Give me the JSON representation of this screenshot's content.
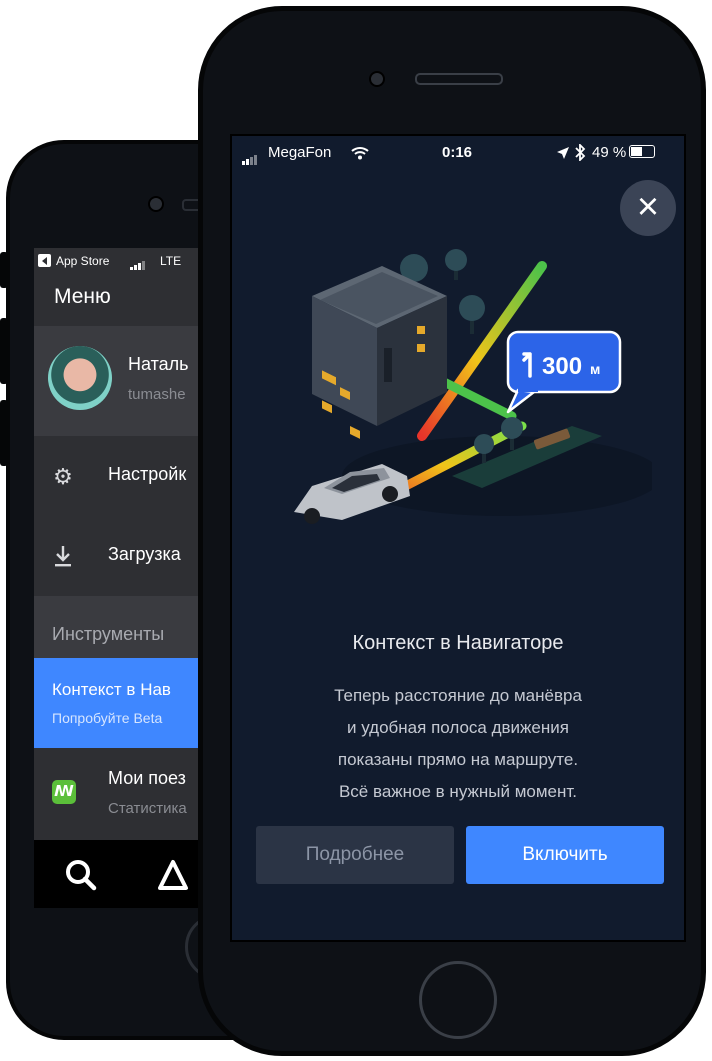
{
  "back_screen": {
    "status": {
      "back_label": "App Store",
      "network": "LTE"
    },
    "menu_title": "Меню",
    "profile": {
      "name": "Наталь",
      "email": "tumashe"
    },
    "items": [
      {
        "label": "Настройк",
        "icon": "gear-icon"
      },
      {
        "label": "Загрузка",
        "icon": "download-icon"
      }
    ],
    "section_title": "Инструменты",
    "highlight": {
      "title": "Контекст в Нав",
      "subtitle": "Попробуйте Beta"
    },
    "trips": {
      "title": "Мои поез",
      "subtitle": "Статистика",
      "icon": "trips-icon"
    },
    "tabbar": [
      {
        "icon": "search-icon"
      },
      {
        "icon": "navigation-arrow-icon"
      }
    ]
  },
  "front_screen": {
    "status": {
      "carrier": "MegaFon",
      "time": "0:16",
      "battery": "49 %"
    },
    "close_icon": "close-icon",
    "illustration": {
      "distance_value": "300",
      "distance_unit": "м",
      "turn_icon": "turn-left-arrow-icon",
      "colors": {
        "route_red": "#e8342a",
        "route_yellow": "#f0c419",
        "route_green": "#4cc24a",
        "bubble": "#2c64e8"
      }
    },
    "title": "Контекст в Навигаторе",
    "description": [
      "Теперь расстояние до манёвра",
      "и удобная полоса движения",
      "показаны прямо на маршруте.",
      "Всё важное в нужный момент."
    ],
    "buttons": {
      "more": "Подробнее",
      "enable": "Включить"
    },
    "colors": {
      "accent": "#3f87ff",
      "background": "#111b2d"
    }
  }
}
